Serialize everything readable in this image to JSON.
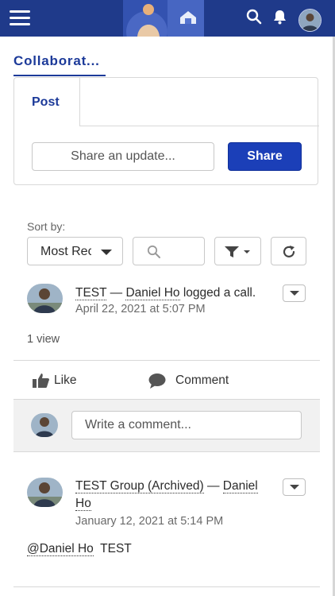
{
  "header": {
    "menu_icon": "hamburger-menu-icon",
    "search_icon": "search-icon",
    "notifications_icon": "bell-icon",
    "brand_color": "#1f3a8a"
  },
  "tabs": {
    "active_label": "Collaborat..."
  },
  "publisher": {
    "tab_label": "Post",
    "input_placeholder": "Share an update...",
    "share_label": "Share"
  },
  "feed_controls": {
    "sort_label": "Sort by:",
    "sort_value": "Most Recent",
    "search_icon": "search-icon",
    "filter_icon": "filter-icon",
    "refresh_icon": "refresh-icon"
  },
  "posts": [
    {
      "group": "TEST",
      "separator": " — ",
      "author": "Daniel Ho",
      "action": " logged a call.",
      "date": "April 22, 2021 at 5:07 PM",
      "views": "1 view",
      "like_label": "Like",
      "comment_label": "Comment",
      "comment_placeholder": "Write a comment..."
    },
    {
      "group": "TEST Group (Archived)",
      "separator": " — ",
      "author_line1": "Daniel",
      "author_line2": "Ho",
      "date": "January 12, 2021 at 5:14 PM",
      "mention": "@Daniel Ho",
      "body": "TEST"
    }
  ]
}
